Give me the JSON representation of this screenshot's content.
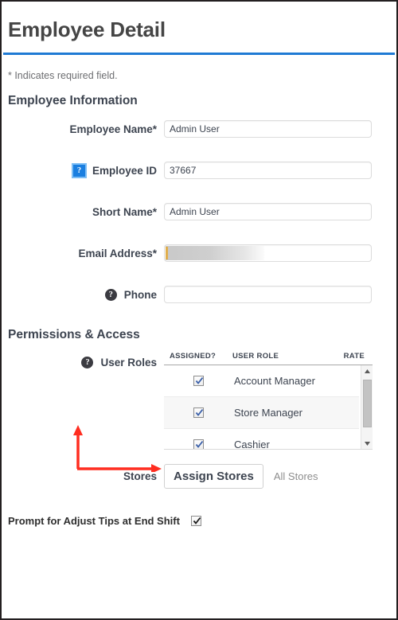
{
  "page": {
    "title": "Employee Detail",
    "required_note": "* Indicates required field.",
    "accent_color": "#1f7ad4",
    "annotation_color": "#ff2d20"
  },
  "sections": {
    "employee_information": {
      "heading": "Employee Information",
      "fields": [
        {
          "label": "Employee Name*",
          "value": "Admin User",
          "placeholder": "",
          "help_icon": null
        },
        {
          "label": "Employee ID",
          "value": "37667",
          "placeholder": "",
          "help_icon": "help-square-icon"
        },
        {
          "label": "Short Name*",
          "value": "Admin User",
          "placeholder": "",
          "help_icon": null
        },
        {
          "label": "Email Address*",
          "value": "",
          "placeholder": "",
          "help_icon": null,
          "redacted": true
        },
        {
          "label": "Phone",
          "value": "",
          "placeholder": "",
          "help_icon": "help-circle-icon"
        }
      ]
    },
    "permissions_access": {
      "heading": "Permissions & Access",
      "user_roles": {
        "label": "User Roles",
        "help_icon": "help-circle-icon",
        "columns": [
          "ASSIGNED?",
          "USER ROLE",
          "RATE"
        ],
        "rows": [
          {
            "assigned": true,
            "role": "Account Manager",
            "rate": ""
          },
          {
            "assigned": true,
            "role": "Store Manager",
            "rate": ""
          },
          {
            "assigned": true,
            "role": "Cashier",
            "rate": ""
          }
        ],
        "scrollbar": {
          "up_icon": "scroll-up-arrow-icon",
          "down_icon": "scroll-down-arrow-icon"
        }
      },
      "stores": {
        "label": "Stores",
        "button_label": "Assign Stores",
        "value_text": "All Stores"
      }
    },
    "prompt_setting": {
      "label": "Prompt for Adjust Tips at End Shift",
      "checked": true
    }
  },
  "help_icon_glyph": "?"
}
